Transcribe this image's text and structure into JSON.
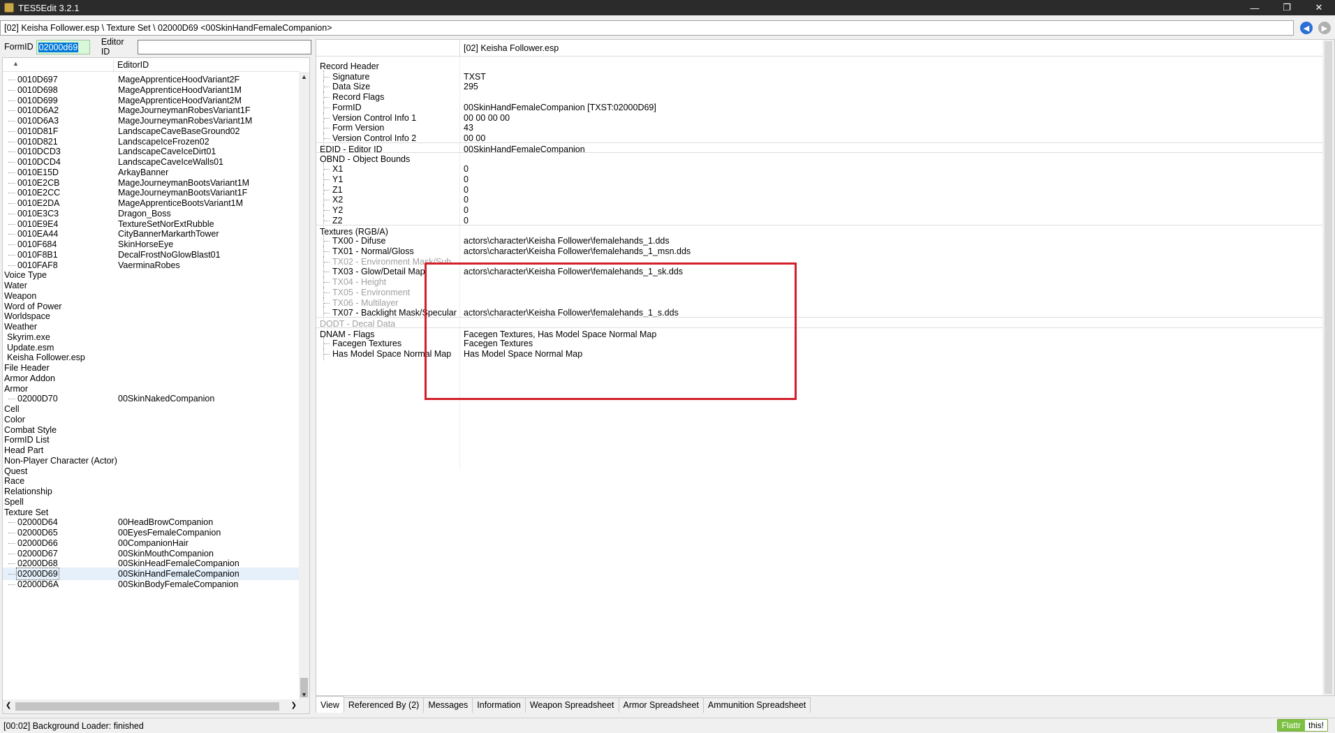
{
  "window": {
    "title": "TES5Edit 3.2.1",
    "min": "—",
    "restore": "❐",
    "close": "✕"
  },
  "pathbar": {
    "text": "[02] Keisha Follower.esp \\ Texture Set \\ 02000D69 <00SkinHandFemaleCompanion>"
  },
  "filter": {
    "formid_label": "FormID",
    "formid_value": "02000d69",
    "editorid_label": "Editor ID",
    "editorid_value": ""
  },
  "tree": {
    "header_sort": "▲",
    "header_col2": "EditorID",
    "rows": [
      {
        "id": "0010D697",
        "name": "MageApprenticeHoodVariant2F",
        "indent": 1
      },
      {
        "id": "0010D698",
        "name": "MageApprenticeHoodVariant1M",
        "indent": 1
      },
      {
        "id": "0010D699",
        "name": "MageApprenticeHoodVariant2M",
        "indent": 1
      },
      {
        "id": "0010D6A2",
        "name": "MageJourneymanRobesVariant1F",
        "indent": 1
      },
      {
        "id": "0010D6A3",
        "name": "MageJourneymanRobesVariant1M",
        "indent": 1
      },
      {
        "id": "0010D81F",
        "name": "LandscapeCaveBaseGround02",
        "indent": 1
      },
      {
        "id": "0010D821",
        "name": "LandscapeIceFrozen02",
        "indent": 1
      },
      {
        "id": "0010DCD3",
        "name": "LandscapeCaveIceDirt01",
        "indent": 1
      },
      {
        "id": "0010DCD4",
        "name": "LandscapeCaveIceWalls01",
        "indent": 1
      },
      {
        "id": "0010E15D",
        "name": "ArkayBanner",
        "indent": 1
      },
      {
        "id": "0010E2CB",
        "name": "MageJourneymanBootsVariant1M",
        "indent": 1
      },
      {
        "id": "0010E2CC",
        "name": "MageJourneymanBootsVariant1F",
        "indent": 1
      },
      {
        "id": "0010E2DA",
        "name": "MageApprenticeBootsVariant1M",
        "indent": 1
      },
      {
        "id": "0010E3C3",
        "name": "Dragon_Boss",
        "indent": 1
      },
      {
        "id": "0010E9E4",
        "name": "TextureSetNorExtRubble",
        "indent": 1
      },
      {
        "id": "0010EA44",
        "name": "CityBannerMarkarthTower",
        "indent": 1
      },
      {
        "id": "0010F684",
        "name": "SkinHorseEye",
        "indent": 1
      },
      {
        "id": "0010F8B1",
        "name": "DecalFrostNoGlowBlast01",
        "indent": 1
      },
      {
        "id": "0010FAF8",
        "name": "VaerminaRobes",
        "indent": 1
      },
      {
        "id": "Voice Type",
        "name": "",
        "indent": 0
      },
      {
        "id": "Water",
        "name": "",
        "indent": 0
      },
      {
        "id": "Weapon",
        "name": "",
        "indent": 0
      },
      {
        "id": "Word of Power",
        "name": "",
        "indent": 0
      },
      {
        "id": "Worldspace",
        "name": "",
        "indent": 0
      },
      {
        "id": "Weather",
        "name": "",
        "indent": 0
      },
      {
        "id": "Skyrim.exe",
        "name": "",
        "indent": 0.5
      },
      {
        "id": "Update.esm",
        "name": "",
        "indent": 0.5
      },
      {
        "id": "Keisha Follower.esp",
        "name": "",
        "indent": 0.5
      },
      {
        "id": "File Header",
        "name": "",
        "indent": 0
      },
      {
        "id": "Armor Addon",
        "name": "",
        "indent": 0
      },
      {
        "id": "Armor",
        "name": "",
        "indent": 0
      },
      {
        "id": "02000D70",
        "name": "00SkinNakedCompanion",
        "indent": 1
      },
      {
        "id": "Cell",
        "name": "",
        "indent": 0
      },
      {
        "id": "Color",
        "name": "",
        "indent": 0
      },
      {
        "id": "Combat Style",
        "name": "",
        "indent": 0
      },
      {
        "id": "FormID List",
        "name": "",
        "indent": 0
      },
      {
        "id": "Head Part",
        "name": "",
        "indent": 0
      },
      {
        "id": "Non-Player Character (Actor)",
        "name": "",
        "indent": 0
      },
      {
        "id": "Quest",
        "name": "",
        "indent": 0
      },
      {
        "id": "Race",
        "name": "",
        "indent": 0
      },
      {
        "id": "Relationship",
        "name": "",
        "indent": 0
      },
      {
        "id": "Spell",
        "name": "",
        "indent": 0
      },
      {
        "id": "Texture Set",
        "name": "",
        "indent": 0
      },
      {
        "id": "02000D64",
        "name": "00HeadBrowCompanion",
        "indent": 1
      },
      {
        "id": "02000D65",
        "name": "00EyesFemaleCompanion",
        "indent": 1
      },
      {
        "id": "02000D66",
        "name": "00CompanionHair",
        "indent": 1
      },
      {
        "id": "02000D67",
        "name": "00SkinMouthCompanion",
        "indent": 1
      },
      {
        "id": "02000D68",
        "name": "00SkinHeadFemaleCompanion",
        "indent": 1
      },
      {
        "id": "02000D69",
        "name": "00SkinHandFemaleCompanion",
        "indent": 1,
        "selected": true
      },
      {
        "id": "02000D6A",
        "name": "00SkinBodyFemaleCompanion",
        "indent": 1
      }
    ]
  },
  "record": {
    "header_file": "[02] Keisha Follower.esp",
    "rows": [
      {
        "k": "Record Header",
        "v": "",
        "level": 0
      },
      {
        "k": "Signature",
        "v": "TXST",
        "level": 1
      },
      {
        "k": "Data Size",
        "v": "295",
        "level": 1
      },
      {
        "k": "Record Flags",
        "v": "",
        "level": 1
      },
      {
        "k": "FormID",
        "v": "00SkinHandFemaleCompanion [TXST:02000D69]",
        "level": 1
      },
      {
        "k": "Version Control Info 1",
        "v": "00 00 00 00",
        "level": 1
      },
      {
        "k": "Form Version",
        "v": "43",
        "level": 1
      },
      {
        "k": "Version Control Info 2",
        "v": "00 00",
        "level": 1
      },
      {
        "k": "EDID - Editor ID",
        "v": "00SkinHandFemaleCompanion",
        "level": 0,
        "sep": true
      },
      {
        "k": "OBND - Object Bounds",
        "v": "",
        "level": 0,
        "sep": true
      },
      {
        "k": "X1",
        "v": "0",
        "level": 1
      },
      {
        "k": "Y1",
        "v": "0",
        "level": 1
      },
      {
        "k": "Z1",
        "v": "0",
        "level": 1
      },
      {
        "k": "X2",
        "v": "0",
        "level": 1
      },
      {
        "k": "Y2",
        "v": "0",
        "level": 1
      },
      {
        "k": "Z2",
        "v": "0",
        "level": 1
      },
      {
        "k": "Textures (RGB/A)",
        "v": "",
        "level": 0,
        "sep": true
      },
      {
        "k": "TX00 - Difuse",
        "v": "actors\\character\\Keisha Follower\\femalehands_1.dds",
        "level": 1
      },
      {
        "k": "TX01 - Normal/Gloss",
        "v": "actors\\character\\Keisha Follower\\femalehands_1_msn.dds",
        "level": 1
      },
      {
        "k": "TX02 - Environment Mask/Sub...",
        "v": "",
        "level": 1,
        "grey": true
      },
      {
        "k": "TX03 - Glow/Detail Map",
        "v": "actors\\character\\Keisha Follower\\femalehands_1_sk.dds",
        "level": 1
      },
      {
        "k": "TX04 - Height",
        "v": "",
        "level": 1,
        "grey": true
      },
      {
        "k": "TX05 - Environment",
        "v": "",
        "level": 1,
        "grey": true
      },
      {
        "k": "TX06 - Multilayer",
        "v": "",
        "level": 1,
        "grey": true
      },
      {
        "k": "TX07 - Backlight Mask/Specular",
        "v": "actors\\character\\Keisha Follower\\femalehands_1_s.dds",
        "level": 1
      },
      {
        "k": "DODT - Decal Data",
        "v": "",
        "level": 0,
        "grey": true,
        "sep": true
      },
      {
        "k": "DNAM - Flags",
        "v": "Facegen Textures, Has Model Space Normal Map",
        "level": 0,
        "sep": true
      },
      {
        "k": "Facegen Textures",
        "v": "Facegen Textures",
        "level": 1
      },
      {
        "k": "Has Model Space Normal Map",
        "v": "Has Model Space Normal Map",
        "level": 1
      }
    ]
  },
  "tabs": [
    "View",
    "Referenced By (2)",
    "Messages",
    "Information",
    "Weapon Spreadsheet",
    "Armor Spreadsheet",
    "Ammunition Spreadsheet"
  ],
  "status": {
    "text": "[00:02] Background Loader: finished",
    "flattr_left": "Flattr",
    "flattr_right": "this!"
  },
  "colors": {
    "highlight": "#d21f2a",
    "selection": "#0078d7"
  }
}
